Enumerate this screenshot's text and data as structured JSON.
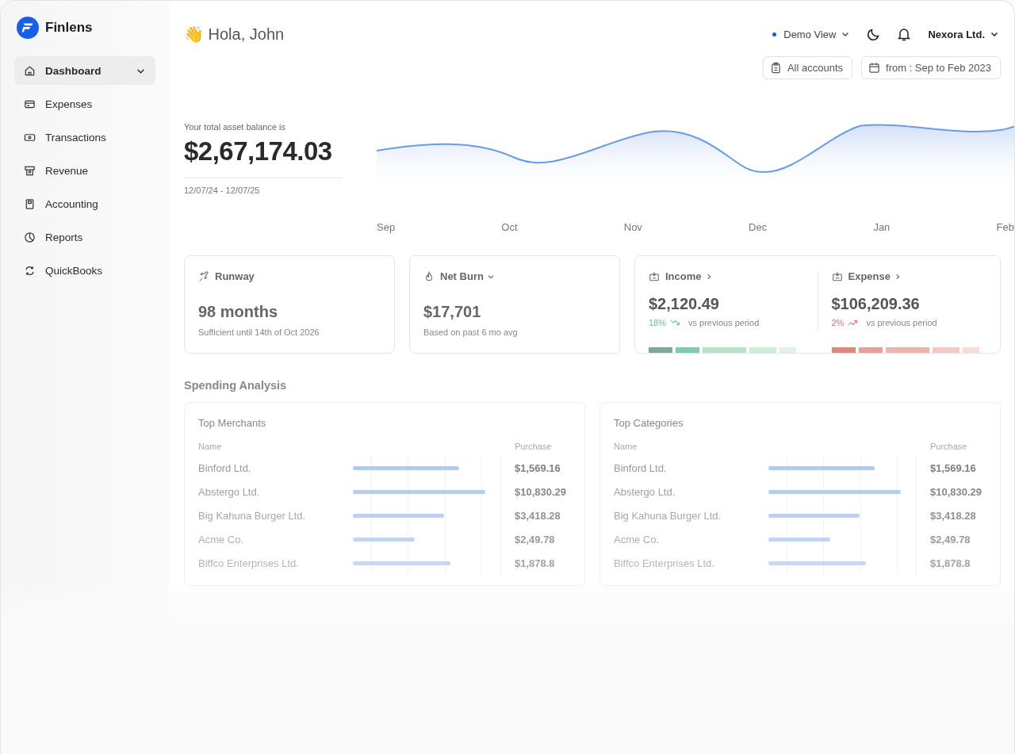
{
  "brand": {
    "name": "Finlens"
  },
  "sidebar": {
    "items": [
      {
        "label": "Dashboard",
        "selected": true,
        "expanded": false
      },
      {
        "label": "Expenses",
        "selected": false
      },
      {
        "label": "Transactions",
        "selected": false
      },
      {
        "label": "Revenue",
        "selected": false
      },
      {
        "label": "Accounting",
        "selected": false
      },
      {
        "label": "Reports",
        "selected": false
      },
      {
        "label": "QuickBooks",
        "selected": false
      }
    ]
  },
  "header": {
    "greeting": "👋 Hola, John",
    "view": {
      "label": "Demo View",
      "color": "#1a56db"
    },
    "company": "Nexora Ltd.",
    "filters": [
      "All accounts",
      "from : Sep to Feb 2023"
    ]
  },
  "balance": {
    "label": "Your total asset balance is",
    "amount": "$2,67,174.03",
    "range": "12/07/24 - 12/07/25",
    "months": [
      "Sep",
      "Oct",
      "Nov",
      "Dec",
      "Jan",
      "Feb"
    ]
  },
  "cards": [
    {
      "title": "Runway",
      "value": "98 months",
      "note": "Sufficient until 14th of Oct 2026"
    },
    {
      "title": "Net Burn",
      "value": "$17,701",
      "note": "Based on past 6 mo avg"
    }
  ],
  "flows": [
    {
      "title": "Income",
      "value": "$2,120.49",
      "change": "18%",
      "kind": "down",
      "note": "vs previous period"
    },
    {
      "title": "Expense",
      "value": "$106,209.36",
      "change": "2%",
      "kind": "up",
      "note": "vs previous period"
    }
  ],
  "spending": {
    "title": "Spending Analysis",
    "tables": [
      {
        "title": "Top Merchants",
        "columns": [
          "Name",
          "Purchase"
        ],
        "rows": [
          {
            "name": "Binford Ltd.",
            "level": 0.72,
            "amount": "$1,569.16"
          },
          {
            "name": "Abstergo Ltd.",
            "level": 0.9,
            "amount": "$10,830.29"
          },
          {
            "name": "Big Kahuna Burger Ltd.",
            "level": 0.62,
            "amount": "$3,418.28"
          },
          {
            "name": "Acme Co.",
            "level": 0.42,
            "amount": "$2,49.78"
          },
          {
            "name": "Biffco Enterprises Ltd.",
            "level": 0.66,
            "amount": "$1,878.8"
          }
        ]
      },
      {
        "title": "Top Categories",
        "columns": [
          "Name",
          "Purchase"
        ],
        "rows": [
          {
            "name": "Binford Ltd.",
            "level": 0.72,
            "amount": "$1,569.16"
          },
          {
            "name": "Abstergo Ltd.",
            "level": 0.9,
            "amount": "$10,830.29"
          },
          {
            "name": "Big Kahuna Burger Ltd.",
            "level": 0.62,
            "amount": "$3,418.28"
          },
          {
            "name": "Acme Co.",
            "level": 0.42,
            "amount": "$2,49.78"
          },
          {
            "name": "Biffco Enterprises Ltd.",
            "level": 0.66,
            "amount": "$1,878.8"
          }
        ]
      }
    ]
  }
}
